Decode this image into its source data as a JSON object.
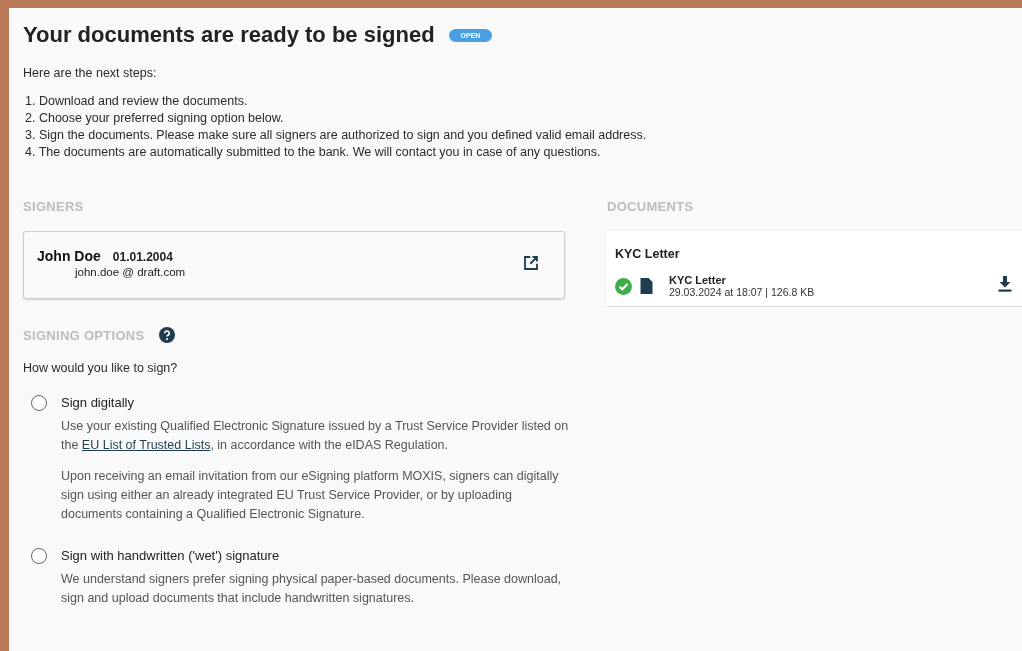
{
  "header": {
    "title": "Your documents are ready to be signed",
    "status": "OPEN"
  },
  "intro": "Here are the next steps:",
  "steps": [
    "1. Download and review the documents.",
    "2. Choose your preferred signing option below.",
    "3. Sign the documents. Please make sure all signers are authorized to sign and you defined valid email address.",
    "4. The documents are automatically submitted to the bank. We will contact you in case of any questions."
  ],
  "signers": {
    "heading": "SIGNERS",
    "items": [
      {
        "name": "John Doe",
        "birth_date": "01.01.2004",
        "email": "john.doe @ draft.com"
      }
    ]
  },
  "signing_options": {
    "heading": "SIGNING OPTIONS",
    "question": "How would you like to sign?",
    "options": [
      {
        "label": "Sign digitally",
        "selected": false,
        "paragraphs": [
          {
            "kind": "link",
            "before": "Use your existing Qualified Electronic Signature issued by a Trust Service Provider listed on the ",
            "link": "EU List of Trusted Lists",
            "after": ", in accordance with the eIDAS Regulation."
          },
          {
            "kind": "text",
            "text": "Upon receiving an email invitation from our eSigning platform MOXIS, signers can digitally sign using either an already integrated EU Trust Service Provider, or by uploading documents containing a Qualified Electronic Signature."
          }
        ]
      },
      {
        "label": "Sign with handwritten ('wet') signature",
        "selected": false,
        "paragraphs": [
          {
            "kind": "text",
            "text": "We understand signers prefer signing physical paper-based documents. Please download, sign and upload documents that include handwritten signatures."
          }
        ]
      }
    ]
  },
  "documents": {
    "heading": "DOCUMENTS",
    "groups": [
      {
        "title": "KYC Letter",
        "files": [
          {
            "name": "KYC Letter",
            "meta": "29.03.2024 at 18:07 | 126.8 KB",
            "verified": true
          }
        ]
      }
    ]
  }
}
